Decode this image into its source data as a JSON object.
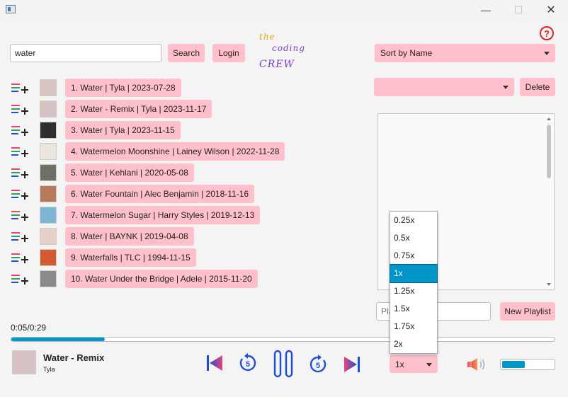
{
  "window": {
    "min_glyph": "—",
    "max_glyph": "☐",
    "close_glyph": "✕"
  },
  "search": {
    "value": "water",
    "button": "Search"
  },
  "login_label": "Login",
  "logo": {
    "line1": "the",
    "line2": "coding",
    "line3": "CREW"
  },
  "help_glyph": "?",
  "sort": {
    "selected": "Sort by Name"
  },
  "playlist": {
    "selected": "",
    "delete_label": "Delete",
    "name_placeholder": "Playlist name",
    "new_label": "New Playlist"
  },
  "songs": [
    {
      "label": "1. Water | Tyla | 2023-07-28",
      "art": "#d9c4bf"
    },
    {
      "label": "2. Water - Remix | Tyla | 2023-11-17",
      "art": "#d6c2c2"
    },
    {
      "label": "3. Water | Tyla | 2023-11-15",
      "art": "#2e2e2e"
    },
    {
      "label": "4. Watermelon Moonshine | Lainey Wilson | 2022-11-28",
      "art": "#ebe6df"
    },
    {
      "label": "5. Water | Kehlani | 2020-05-08",
      "art": "#6f6f63"
    },
    {
      "label": "6. Water Fountain | Alec Benjamin | 2018-11-16",
      "art": "#b47a5a"
    },
    {
      "label": "7. Watermelon Sugar | Harry Styles | 2019-12-13",
      "art": "#7fb6d8"
    },
    {
      "label": "8. Water | BAYNK | 2019-04-08",
      "art": "#e8cfc8"
    },
    {
      "label": "9. Waterfalls | TLC | 1994-11-15",
      "art": "#d3592f"
    },
    {
      "label": "10. Water Under the Bridge | Adele | 2015-11-20",
      "art": "#8a8a8a"
    }
  ],
  "player": {
    "time": "0:05/0:29",
    "progress": 0.172,
    "title": "Water - Remix",
    "artist": "Tyla",
    "speed": "1x",
    "skip_seconds": "5",
    "volume": 0.45
  },
  "speed_options": [
    "0.25x",
    "0.5x",
    "0.75x",
    "1x",
    "1.25x",
    "1.5x",
    "1.75x",
    "2x"
  ],
  "speed_selected_index": 3,
  "colors": {
    "pink": "#ffc0cb",
    "accent": "#0096c9",
    "control_pink": "#e8437a",
    "control_blue": "#1d4fd6"
  }
}
